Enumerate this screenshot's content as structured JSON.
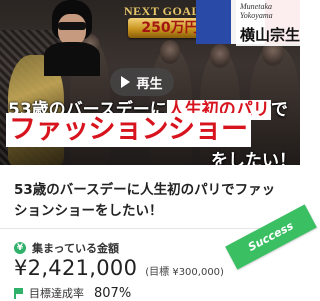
{
  "hero": {
    "next_goal_label": "NEXT GOAL",
    "next_goal_amount": "250万円",
    "name_roman_line1": "Munetaka",
    "name_roman_line2": "Yokoyama",
    "name_jp": "横山宗生",
    "play_label": "再生",
    "headline_prefix": "53歳のバースデーに",
    "headline_red": "人生初のパリ",
    "headline_suffix": "で",
    "headline_big": "ファッションショー",
    "headline_tail": "をしたい！"
  },
  "project": {
    "title": "53歳のバースデーに人生初のパリでファッションショーをしたい！"
  },
  "stats": {
    "raised_label": "集まっている金額",
    "raised_amount": "¥2,421,000",
    "goal_text": "(目標 ¥300,000)",
    "badge": "Success",
    "rate_label": "目標達成率",
    "rate_value": "807%"
  },
  "colors": {
    "accent_green": "#3bbf63",
    "headline_red": "#d7141d",
    "gold": "#c9951f"
  },
  "icons": {
    "play": "play-icon",
    "coin": "coin-icon",
    "goal_flag": "flag-icon"
  }
}
